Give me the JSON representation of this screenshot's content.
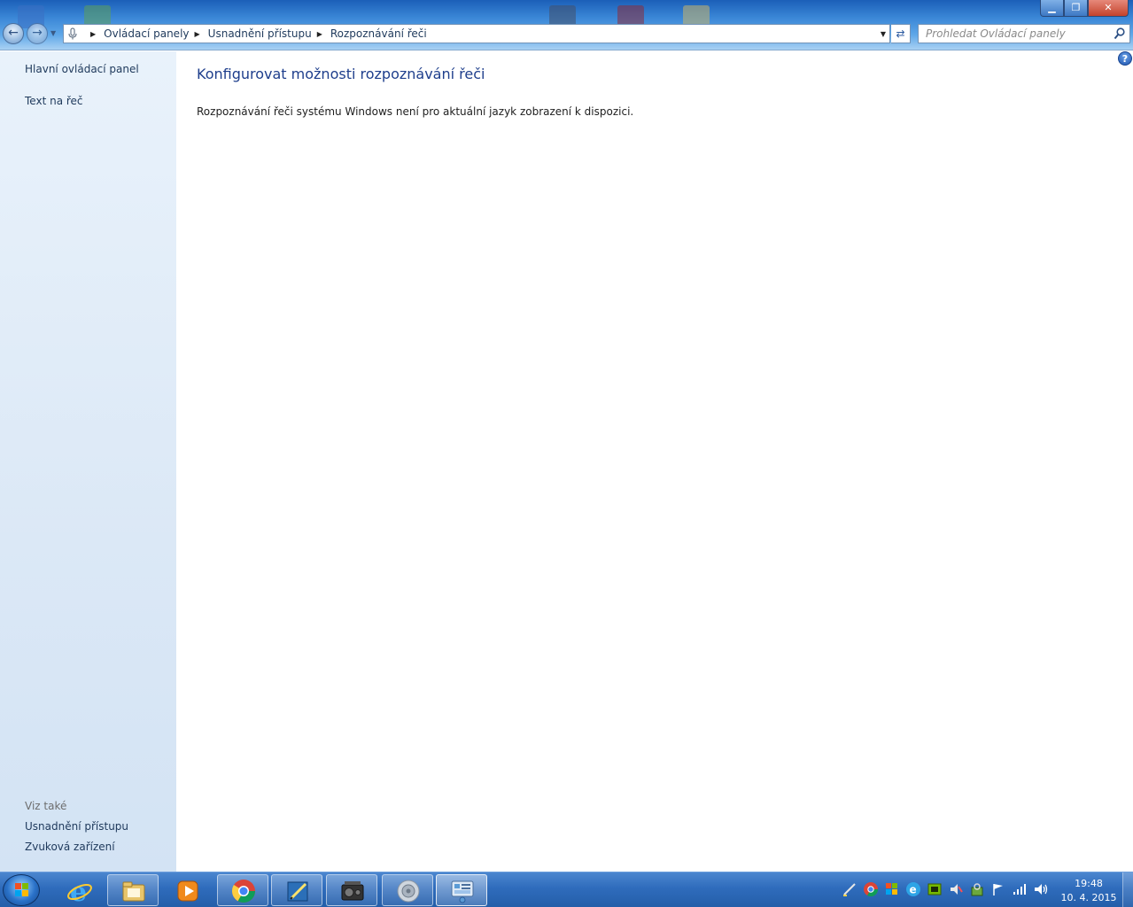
{
  "window": {
    "controls": {
      "minimize": "▁",
      "restore": "❐",
      "close": "✕"
    }
  },
  "nav": {
    "breadcrumb": [
      "Ovládací panely",
      "Usnadnění přístupu",
      "Rozpoznávání řeči"
    ],
    "search_placeholder": "Prohledat Ovládací panely"
  },
  "sidebar": {
    "links": [
      "Hlavní ovládací panel",
      "Text na řeč"
    ],
    "see_also_heading": "Viz také",
    "see_also_links": [
      "Usnadnění přístupu",
      "Zvuková zařízení"
    ]
  },
  "content": {
    "title": "Konfigurovat možnosti rozpoznávání řeči",
    "message": "Rozpoznávání řeči systému Windows není pro aktuální jazyk zobrazení k dispozici."
  },
  "taskbar": {
    "items": [
      "internet-explorer-icon",
      "explorer-icon",
      "media-player-icon",
      "chrome-icon",
      "editor-icon",
      "video-icon",
      "speaker-icon",
      "control-panel-icon"
    ],
    "clock_time": "19:48",
    "clock_date": "10. 4. 2015"
  },
  "colors": {
    "accent": "#1e3e8c",
    "link": "#1e395b",
    "taskbar": "#2f6cbc"
  }
}
